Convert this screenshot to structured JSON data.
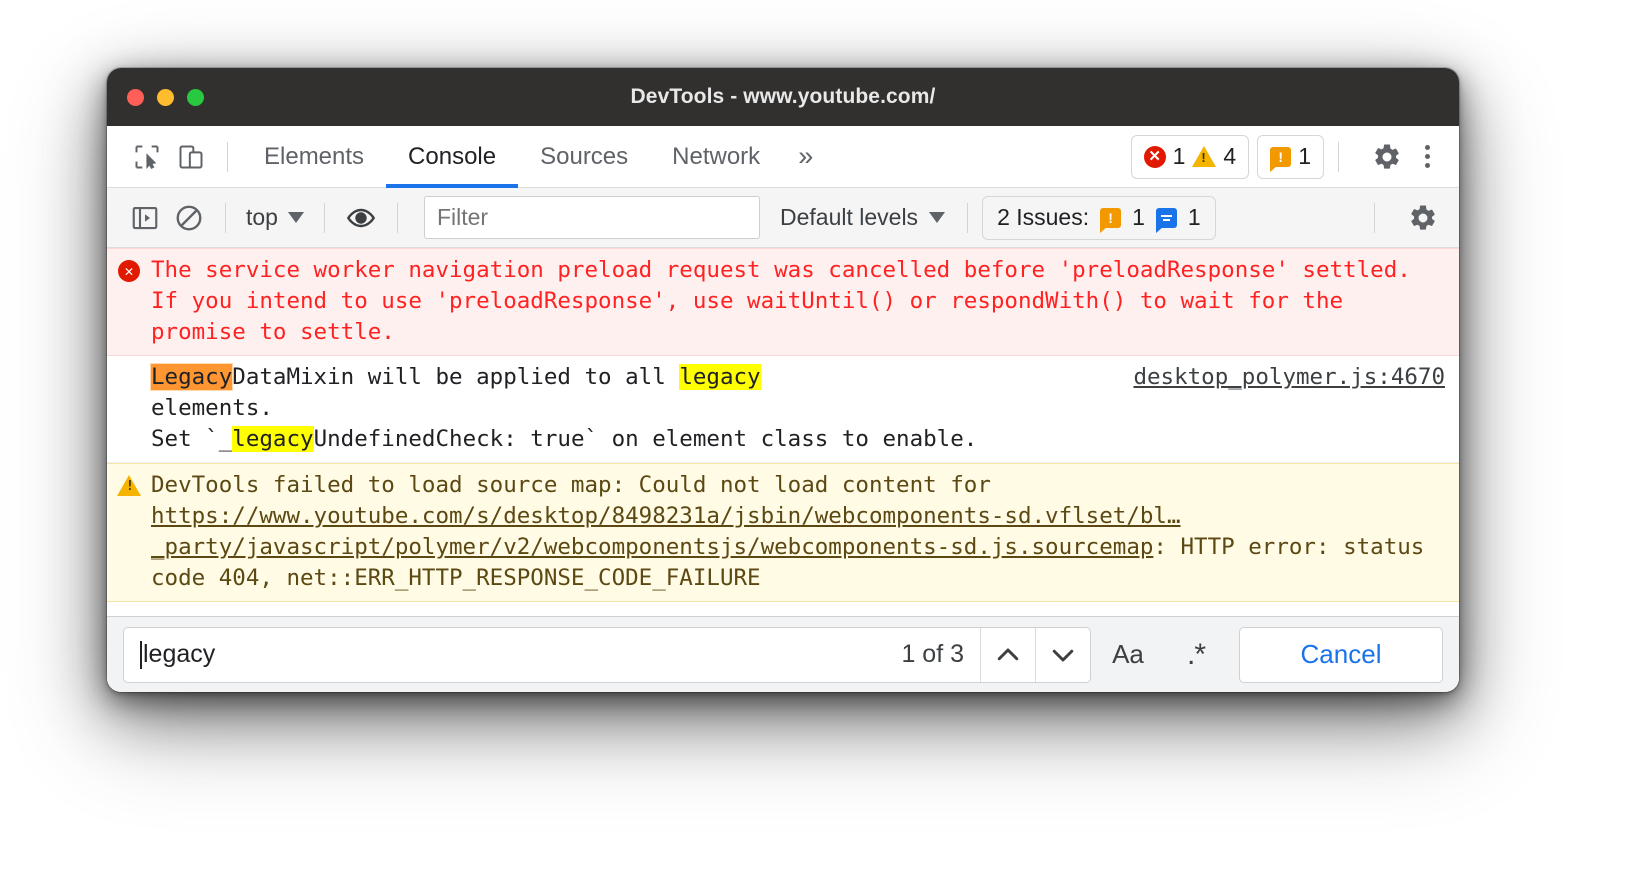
{
  "window": {
    "title": "DevTools - www.youtube.com/",
    "traffic_lights": [
      "close",
      "minimize",
      "zoom"
    ]
  },
  "tabbar": {
    "icons": [
      "inspect-element-icon",
      "device-toolbar-icon"
    ],
    "tabs": [
      {
        "label": "Elements",
        "active": false
      },
      {
        "label": "Console",
        "active": true
      },
      {
        "label": "Sources",
        "active": false
      },
      {
        "label": "Network",
        "active": false
      }
    ],
    "more_label": "»",
    "error_count": "1",
    "warning_count": "4",
    "issue_count": "1",
    "settings_label": "settings-gear",
    "menu_label": "more-options"
  },
  "console_toolbar": {
    "sidebar_toggle": "console-sidebar-icon",
    "clear_label": "clear-console-icon",
    "context": "top",
    "eye_label": "live-expression-icon",
    "filter_placeholder": "Filter",
    "filter_value": "",
    "levels": "Default levels",
    "issues_label": "2 Issues:",
    "issues_error_count": "1",
    "issues_info_count": "1",
    "settings_label": "console-settings-gear"
  },
  "messages": [
    {
      "type": "error",
      "icon": "error-icon",
      "text": "The service worker navigation preload request was cancelled before 'preloadResponse' settled. If you intend to use 'preloadResponse', use waitUntil() or respondWith() to wait for the promise to settle.",
      "source": ""
    },
    {
      "type": "verbose",
      "icon": "none",
      "line1_a": "Legacy",
      "line1_b": "DataMixin will be applied to all ",
      "line1_c": "legacy",
      "line2": "elements.",
      "line3_a": "Set `_",
      "line3_b": "legacy",
      "line3_c": "UndefinedCheck: true` on element class to enable.",
      "source": "desktop_polymer.js:4670"
    },
    {
      "type": "warning",
      "icon": "warning-icon",
      "prefix": "DevTools failed to load source map: Could not load content for ",
      "url": "https://www.youtube.com/s/desktop/8498231a/jsbin/webcomponents-sd.vflset/bl…_party/javascript/polymer/v2/webcomponentsjs/webcomponents-sd.js.sourcemap",
      "suffix": ": HTTP error: status code 404, net::ERR_HTTP_RESPONSE_CODE_FAILURE"
    }
  ],
  "search": {
    "query": "legacy",
    "match_count": "1 of 3",
    "prev_label": "prev-match-chevron-up",
    "next_label": "next-match-chevron-down",
    "match_case_label": "Aa",
    "regex_label": ".*",
    "cancel_label": "Cancel"
  },
  "colors": {
    "accent": "#1a73e8",
    "error_bg": "#fff0f0",
    "error_text": "#ff2222",
    "warning_bg": "#fffbe5",
    "warning_text": "#5c4813",
    "highlight_active": "#ff9632",
    "highlight": "#ffff00",
    "titlebar": "#32302f"
  }
}
